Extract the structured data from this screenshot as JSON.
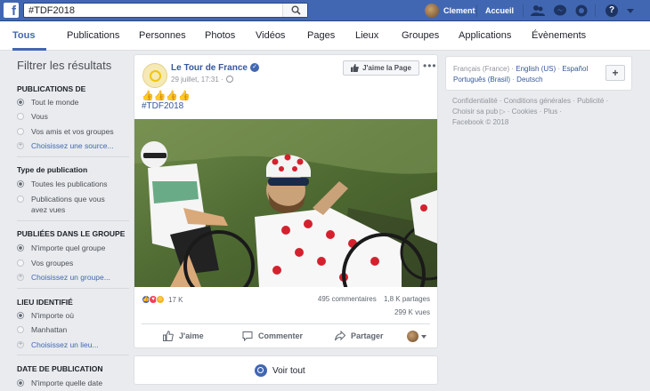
{
  "topbar": {
    "logo": "f",
    "search_value": "#TDF2018",
    "user_name": "Clement",
    "home_label": "Accueil",
    "help_label": "?"
  },
  "tabs": [
    {
      "label": "Tous"
    },
    {
      "label": "Publications"
    },
    {
      "label": "Personnes"
    },
    {
      "label": "Photos"
    },
    {
      "label": "Vidéos"
    },
    {
      "label": "Pages"
    },
    {
      "label": "Lieux"
    },
    {
      "label": "Groupes"
    },
    {
      "label": "Applications"
    },
    {
      "label": "Évènements"
    }
  ],
  "filters": {
    "title": "Filtrer les résultats",
    "publications_de": {
      "heading": "PUBLICATIONS DE",
      "options": [
        "Tout le monde",
        "Vous",
        "Vos amis et vos groupes"
      ],
      "link": "Choisissez une source..."
    },
    "type": {
      "heading": "Type de publication",
      "options": [
        "Toutes les publications",
        "Publications que vous avez vues"
      ]
    },
    "groupe": {
      "heading": "PUBLIÉES DANS LE GROUPE",
      "options": [
        "N'importe quel groupe",
        "Vos groupes"
      ],
      "link": "Choisissez un groupe..."
    },
    "lieu": {
      "heading": "LIEU IDENTIFIÉ",
      "options": [
        "N'importe où",
        "Manhattan"
      ],
      "link": "Choisissez un lieu..."
    },
    "date": {
      "heading": "DATE DE PUBLICATION",
      "options": [
        "N'importe quelle date"
      ]
    }
  },
  "post": {
    "page_name": "Le Tour de France",
    "date": "29 juillet, 17:31 ·",
    "like_page_label": "J'aime la Page",
    "more_label": "•••",
    "emojis": "👍👍👍👍",
    "hashtag": "#TDF2018",
    "reactions_count": "17 K",
    "comments": "495 commentaires",
    "shares": "1,8 K partages",
    "views": "299 K vues",
    "actions": {
      "like": "J'aime",
      "comment": "Commenter",
      "share": "Partager"
    }
  },
  "see_all": "Voir tout",
  "languages": {
    "current": "Français (France)",
    "line1_links": [
      "English (US)",
      "Español"
    ],
    "line2_links": [
      "Português (Brasil)",
      "Deutsch"
    ],
    "sep": "·",
    "plus": "+"
  },
  "footer": {
    "line1": "Confidentialité · Conditions générales · Publicité ·",
    "line2": "Choisir sa pub ▷ · Cookies · Plus ·",
    "line3": "Facebook © 2018"
  },
  "colors": {
    "brand": "#4267b2",
    "link": "#365899",
    "polka_red": "#d5212e"
  }
}
